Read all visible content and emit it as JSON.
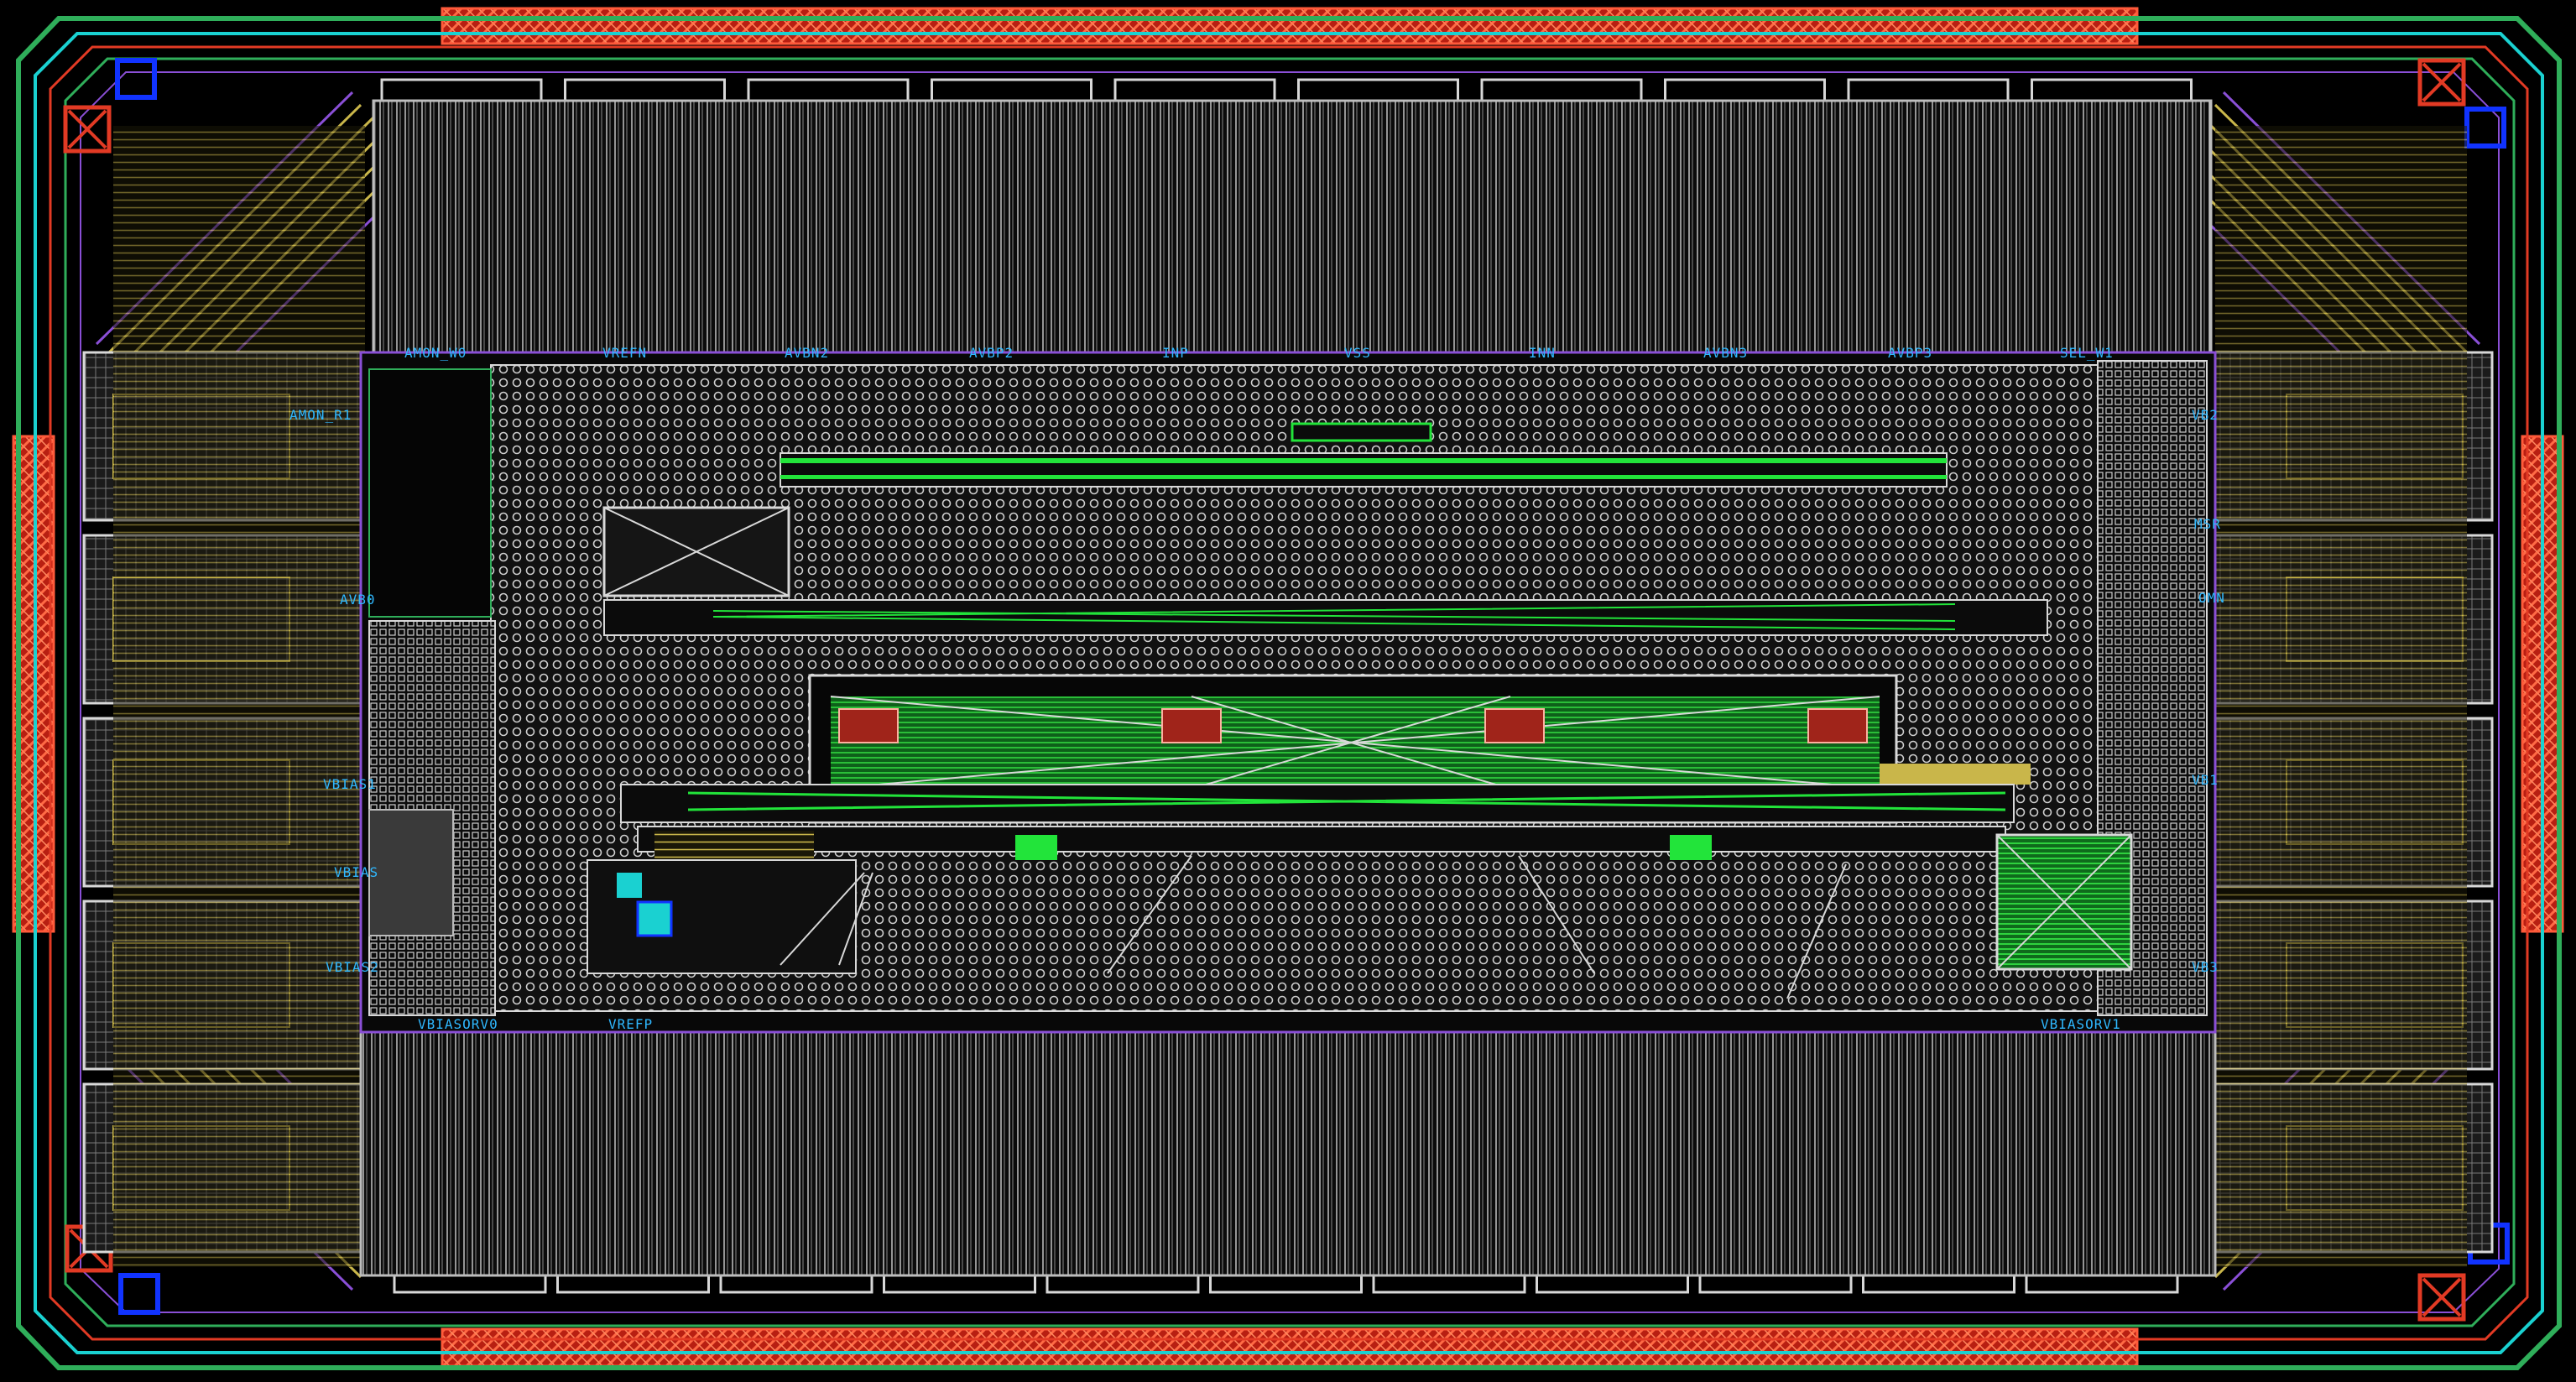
{
  "view": "Chip layout",
  "colors": {
    "background": "#000000",
    "seal_ring": "#e23a24",
    "guard_green": "#2fae5a",
    "guard_cyan": "#1ad1d1",
    "metal_yellow": "#c9b64a",
    "metal_purple": "#8a4fd6",
    "active_green": "#22e43a",
    "via_white": "#d8d8d8",
    "corner_blue": "#1133ff",
    "label_blue": "#2fb8ff"
  },
  "pins": {
    "top": [
      "AMON_W0",
      "VREFN",
      "AVBN2",
      "AVBP2",
      "INP",
      "VSS",
      "INN",
      "AVBN3",
      "AVBP3",
      "SEL_W1"
    ],
    "bottom": [
      "VBIASORV0",
      "VREFP",
      "VBIASORV1"
    ],
    "left": [
      "AMON_R1",
      "AVB0",
      "VBIAS1",
      "VBIAS",
      "VBIAS2"
    ],
    "right": [
      "VB2",
      "MSR",
      "OMN",
      "VB1",
      "VB3"
    ]
  },
  "icons": {
    "corner_marker": "crossed-square-icon",
    "seal_ring_pattern": "hatched-bar"
  }
}
